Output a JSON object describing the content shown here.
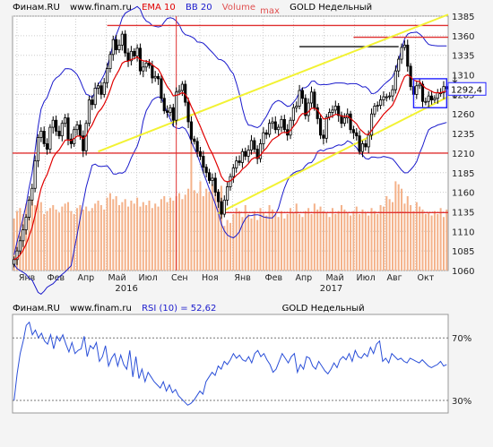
{
  "header": {
    "brand": "Финам.RU",
    "site": "www.finam.ru",
    "ind1": "EMA 10",
    "ind2": "BB 20",
    "ind3": "Volume",
    "ind4": "max",
    "ticker": "GOLD Недельный"
  },
  "rsi_header": {
    "brand": "Финам.RU",
    "site": "www.finam.ru",
    "label": "RSI (10) = 52,62",
    "ticker": "GOLD Недельный"
  },
  "colors": {
    "up": "#ffffff",
    "down": "#000000",
    "ema": "#e00000",
    "bb": "#1a1acc",
    "volume": "#f4b28a",
    "channel": "#f2f233",
    "level": "#e03030",
    "rsi": "#2a4fd8",
    "grid": "#cccccc"
  },
  "chart_data": [
    {
      "type": "candlestick",
      "title": "GOLD Недельный",
      "ylim": [
        1060,
        1385
      ],
      "y_ticks": [
        1385,
        1360,
        1335,
        1310,
        1285,
        1260,
        1235,
        1210,
        1185,
        1160,
        1135,
        1110,
        1085,
        1060
      ],
      "x_ticks": [
        "Янв",
        "Фев",
        "Апр",
        "Май",
        "Июл",
        "Сен",
        "Ноя",
        "Янв",
        "Фев",
        "Апр",
        "Май",
        "Июл",
        "Авг",
        "Окт"
      ],
      "year_labels": [
        "2016",
        "2017"
      ],
      "last_price_label": "1292,4",
      "horizontal_levels": [
        1373,
        1358,
        1346,
        1292,
        1210,
        1134
      ],
      "series": [
        {
          "name": "EMA 10",
          "kind": "line"
        },
        {
          "name": "BB 20",
          "kind": "bands"
        },
        {
          "name": "Volume",
          "kind": "bars"
        }
      ],
      "close": [
        1074,
        1085,
        1098,
        1112,
        1128,
        1150,
        1165,
        1200,
        1230,
        1238,
        1222,
        1215,
        1243,
        1252,
        1238,
        1232,
        1248,
        1255,
        1228,
        1222,
        1240,
        1246,
        1232,
        1213,
        1248,
        1278,
        1272,
        1293,
        1296,
        1285,
        1300,
        1318,
        1336,
        1355,
        1342,
        1348,
        1362,
        1338,
        1328,
        1340,
        1334,
        1344,
        1315,
        1320,
        1325,
        1322,
        1306,
        1308,
        1305,
        1280,
        1264,
        1262,
        1268,
        1252,
        1288,
        1290,
        1298,
        1275,
        1250,
        1228,
        1225,
        1212,
        1206,
        1192,
        1185,
        1175,
        1178,
        1160,
        1148,
        1132,
        1150,
        1167,
        1180,
        1191,
        1200,
        1198,
        1212,
        1206,
        1214,
        1226,
        1215,
        1203,
        1222,
        1236,
        1234,
        1248,
        1250,
        1240,
        1243,
        1253,
        1240,
        1233,
        1252,
        1268,
        1270,
        1290,
        1280,
        1258,
        1274,
        1288,
        1268,
        1254,
        1233,
        1229,
        1256,
        1262,
        1265,
        1270,
        1258,
        1248,
        1255,
        1260,
        1240,
        1236,
        1232,
        1212,
        1222,
        1218,
        1233,
        1260,
        1270,
        1271,
        1278,
        1282,
        1282,
        1283,
        1291,
        1315,
        1330,
        1345,
        1348,
        1321,
        1295,
        1285,
        1296,
        1298,
        1276,
        1276,
        1283,
        1278,
        1280,
        1287,
        1287,
        1295,
        1292
      ],
      "volume_ylim": [
        0,
        100
      ],
      "volume": [
        35,
        40,
        42,
        38,
        45,
        48,
        50,
        44,
        47,
        46,
        38,
        40,
        42,
        44,
        41,
        39,
        43,
        45,
        46,
        40,
        38,
        42,
        44,
        41,
        43,
        40,
        42,
        45,
        47,
        44,
        41,
        49,
        52,
        48,
        50,
        44,
        46,
        48,
        43,
        47,
        45,
        49,
        43,
        46,
        44,
        47,
        42,
        45,
        43,
        48,
        50,
        46,
        49,
        47,
        50,
        52,
        48,
        51,
        55,
        90,
        54,
        52,
        60,
        50,
        55,
        53,
        58,
        56,
        54,
        57,
        30,
        34,
        32,
        38,
        42,
        40,
        36,
        44,
        38,
        35,
        40,
        34,
        42,
        39,
        37,
        44,
        41,
        38,
        36,
        40,
        35,
        38,
        42,
        39,
        45,
        38,
        36,
        40,
        42,
        38,
        45,
        41,
        43,
        40,
        39,
        36,
        42,
        38,
        40,
        44,
        41,
        39,
        37,
        40,
        43,
        38,
        41,
        39,
        37,
        42,
        40,
        38,
        44,
        43,
        50,
        48,
        46,
        60,
        58,
        55,
        45,
        50,
        44,
        40,
        46,
        43,
        41,
        38,
        39,
        37,
        40,
        38,
        42,
        36,
        41
      ]
    },
    {
      "type": "line",
      "title": "RSI (10) = 52,62",
      "ylim": [
        0,
        100
      ],
      "y_ticks": [
        70,
        30
      ],
      "y_tick_labels": [
        "70%",
        "30%"
      ],
      "series": [
        {
          "name": "RSI (10)",
          "values": [
            30,
            47,
            60,
            68,
            78,
            80,
            72,
            75,
            70,
            73,
            68,
            66,
            72,
            63,
            71,
            68,
            72,
            66,
            61,
            67,
            60,
            62,
            63,
            71,
            58,
            65,
            63,
            67,
            55,
            58,
            65,
            52,
            57,
            60,
            52,
            59,
            53,
            50,
            62,
            45,
            58,
            44,
            50,
            42,
            48,
            45,
            42,
            40,
            38,
            42,
            36,
            40,
            35,
            37,
            33,
            31,
            29,
            27,
            28,
            30,
            33,
            36,
            34,
            42,
            45,
            48,
            46,
            52,
            50,
            55,
            53,
            56,
            60,
            57,
            59,
            56,
            55,
            58,
            54,
            60,
            62,
            58,
            60,
            56,
            53,
            48,
            50,
            55,
            60,
            57,
            54,
            58,
            60,
            48,
            53,
            50,
            58,
            57,
            52,
            50,
            55,
            52,
            49,
            47,
            50,
            54,
            51,
            56,
            58,
            56,
            60,
            55,
            62,
            58,
            57,
            60,
            58,
            64,
            60,
            66,
            68,
            55,
            57,
            54,
            60,
            58,
            56,
            57,
            55,
            54,
            57,
            56,
            55,
            54,
            56,
            54,
            52,
            51,
            52,
            53,
            55,
            52,
            53
          ]
        }
      ]
    }
  ]
}
